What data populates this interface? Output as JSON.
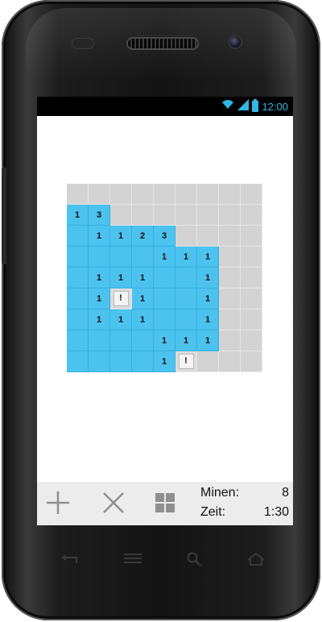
{
  "status": {
    "time": "12:00",
    "accent_color": "#33b5e5",
    "icons": [
      "wifi-icon",
      "signal-icon",
      "battery-icon"
    ]
  },
  "board": {
    "rows": 9,
    "cols": 9,
    "open_color": "#4cc2ef",
    "closed_color": "#d3d3d3",
    "cells": [
      [
        "",
        "",
        "",
        "",
        "",
        "",
        "",
        "",
        ""
      ],
      [
        "1",
        "3",
        "#",
        "#",
        "#",
        "#",
        "#",
        "#",
        "#"
      ],
      [
        "",
        "1",
        "1",
        "2",
        "3",
        "#",
        "#",
        "#",
        "#"
      ],
      [
        "",
        "",
        "",
        "",
        "1",
        "1",
        "1",
        "#",
        "#"
      ],
      [
        "",
        "1",
        "1",
        "1",
        "",
        "",
        "1",
        "#",
        "#"
      ],
      [
        "",
        "1",
        "!",
        "1",
        "",
        "",
        "1",
        "#",
        "#"
      ],
      [
        "",
        "1",
        "1",
        "1",
        "",
        "",
        "1",
        "#",
        "#"
      ],
      [
        "",
        "",
        "",
        "",
        "1",
        "1",
        "1",
        "#",
        "#"
      ],
      [
        "",
        "",
        "",
        "",
        "1",
        "!",
        "#",
        "#",
        "#"
      ]
    ],
    "open_mask": [
      [
        0,
        0,
        0,
        0,
        0,
        0,
        0,
        0,
        0
      ],
      [
        1,
        1,
        0,
        0,
        0,
        0,
        0,
        0,
        0
      ],
      [
        1,
        1,
        1,
        1,
        1,
        0,
        0,
        0,
        0
      ],
      [
        1,
        1,
        1,
        1,
        1,
        1,
        1,
        0,
        0
      ],
      [
        1,
        1,
        1,
        1,
        1,
        1,
        1,
        0,
        0
      ],
      [
        1,
        1,
        0,
        1,
        1,
        1,
        1,
        0,
        0
      ],
      [
        1,
        1,
        1,
        1,
        1,
        1,
        1,
        0,
        0
      ],
      [
        1,
        1,
        1,
        1,
        1,
        1,
        1,
        0,
        0
      ],
      [
        1,
        1,
        1,
        1,
        1,
        0,
        0,
        0,
        0
      ]
    ]
  },
  "toolbar": {
    "buttons": [
      {
        "name": "new-game-button",
        "icon": "plus-icon"
      },
      {
        "name": "close-button",
        "icon": "close-icon"
      },
      {
        "name": "menu-grid-button",
        "icon": "grid-icon"
      }
    ]
  },
  "info": {
    "mines_label": "Minen:",
    "mines_value": "8",
    "time_label": "Zeit:",
    "time_value": "1:30"
  },
  "navigation": {
    "icons": [
      "back-icon",
      "menu-icon",
      "search-icon",
      "home-icon"
    ]
  }
}
